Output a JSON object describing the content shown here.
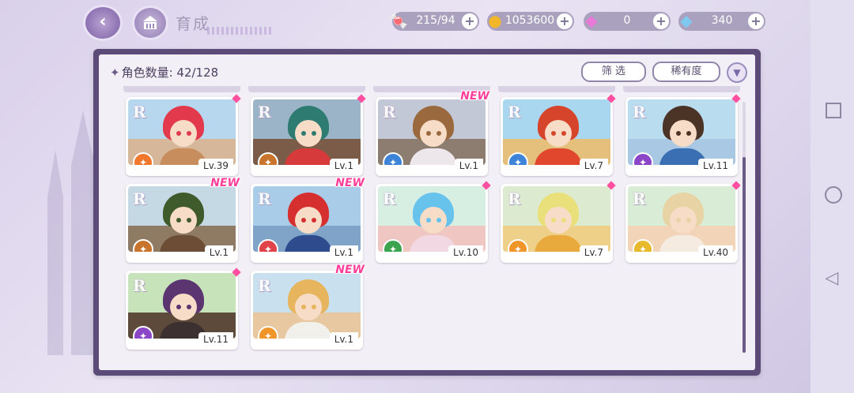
{
  "header": {
    "title": "育成",
    "resources": [
      {
        "id": "candy",
        "value": "215/94",
        "icon": "candy-icon",
        "color": "#ff7ea6"
      },
      {
        "id": "coin",
        "value": "1053600",
        "icon": "coin-icon",
        "color": "#f2b62a"
      },
      {
        "id": "pink-diamond",
        "value": "0",
        "icon": "pink-diamond-icon",
        "color": "#e979d8"
      },
      {
        "id": "blue-diamond",
        "value": "340",
        "icon": "blue-diamond-icon",
        "color": "#7fc8ef"
      }
    ]
  },
  "panel": {
    "count_label": "角色数量: 42/128",
    "filter_label": "筛 选",
    "rarity_label": "稀有度"
  },
  "cards": [
    {
      "rarity": "R",
      "level": "Lv.39",
      "badge": "gem",
      "attr_color": "#f0772c",
      "hair": "#e23a4c",
      "sky": "#b7d7ef",
      "ground": "#d7b79a",
      "body": "#c88d5c"
    },
    {
      "rarity": "R",
      "level": "Lv.1",
      "badge": "gem",
      "attr_color": "#c8742c",
      "hair": "#2e7b72",
      "sky": "#9cb4c8",
      "ground": "#7b5c48",
      "body": "#d63a3a"
    },
    {
      "rarity": "R",
      "level": "Lv.1",
      "badge": "NEW",
      "attr_color": "#3d84d8",
      "hair": "#9a6a3e",
      "sky": "#c3c8d6",
      "ground": "#8d7d70",
      "body": "#ede6ea"
    },
    {
      "rarity": "R",
      "level": "Lv.7",
      "badge": "gem",
      "attr_color": "#3d84d8",
      "hair": "#d6452b",
      "sky": "#a9d7ef",
      "ground": "#e5c07d",
      "body": "#e0472c"
    },
    {
      "rarity": "R",
      "level": "Lv.11",
      "badge": "gem",
      "attr_color": "#8b46c7",
      "hair": "#4b3326",
      "sky": "#b9dcef",
      "ground": "#a8c8e3",
      "body": "#3a6fb3"
    },
    {
      "rarity": "R",
      "level": "Lv.1",
      "badge": "NEW",
      "attr_color": "#c8742c",
      "hair": "#3f5a2b",
      "sky": "#c5d9e5",
      "ground": "#8f7a63",
      "body": "#6c4e36"
    },
    {
      "rarity": "R",
      "level": "Lv.1",
      "badge": "NEW",
      "attr_color": "#e0434a",
      "hair": "#d52f2f",
      "sky": "#a9cde8",
      "ground": "#7fa4c8",
      "body": "#2e4b8d"
    },
    {
      "rarity": "R",
      "level": "Lv.10",
      "badge": "gem",
      "attr_color": "#3ca34f",
      "hair": "#67c3ec",
      "sky": "#d7efe3",
      "ground": "#f0c6c3",
      "body": "#f2d8e2"
    },
    {
      "rarity": "R",
      "level": "Lv.7",
      "badge": "gem",
      "attr_color": "#f0952a",
      "hair": "#e9e07c",
      "sky": "#dcebd0",
      "ground": "#efd089",
      "body": "#e9a93c"
    },
    {
      "rarity": "R",
      "level": "Lv.40",
      "badge": "gem",
      "attr_color": "#e9b92c",
      "hair": "#e8d3a4",
      "sky": "#d9ecd5",
      "ground": "#f2d5b8",
      "body": "#f6ebe0"
    },
    {
      "rarity": "R",
      "level": "Lv.11",
      "badge": "gem",
      "attr_color": "#8b46c7",
      "hair": "#5a3570",
      "sky": "#c7e3ba",
      "ground": "#5d4a3a",
      "body": "#3c3030"
    },
    {
      "rarity": "R",
      "level": "Lv.1",
      "badge": "NEW",
      "attr_color": "#f0952a",
      "hair": "#e6b55d",
      "sky": "#c9e0ef",
      "ground": "#e7c8a0",
      "body": "#f2f0ea"
    }
  ]
}
